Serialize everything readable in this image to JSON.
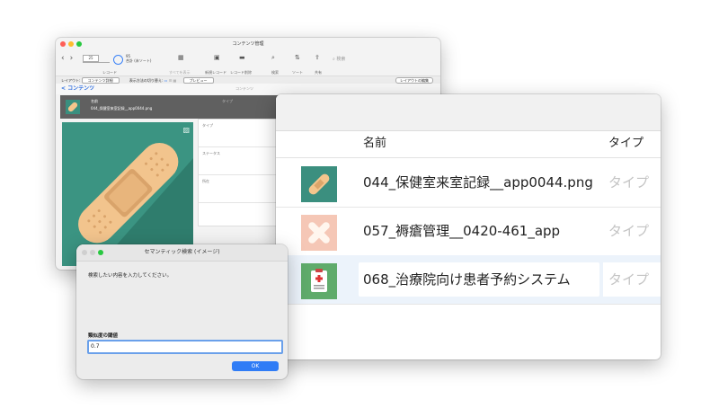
{
  "main_window": {
    "title": "コンテンツ管理",
    "toolbar": {
      "record_number": "25",
      "record_count": "95",
      "record_count_label": "合計 (未ソート)",
      "records_label": "レコード",
      "show_all": "すべてを表示",
      "new_record": "新規レコード",
      "delete_record": "レコード削除",
      "find": "検索",
      "sort": "ソート",
      "share": "共有",
      "search_placeholder": "検索"
    },
    "layout_bar": {
      "layout_label": "レイアウト:",
      "layout_value": "コンテンツ詳細",
      "view_label": "表示方法の切り替え:",
      "preview": "プレビュー",
      "edit_layout": "レイアウトの編集"
    },
    "nav": {
      "back": "< コンテンツ",
      "center_title": "コンテンツ"
    },
    "record": {
      "name_label": "名前",
      "name": "044_保健室来室記録__app0044.png",
      "type_label": "タイプ"
    },
    "fields": [
      "タイプ",
      "ステータス",
      "所在"
    ]
  },
  "table_window": {
    "columns": {
      "name": "名前",
      "type": "タイプ"
    },
    "rows": [
      {
        "name": "044_保健室来室記録__app0044.png",
        "type": "タイプ",
        "thumb_color": "#3b8f7f"
      },
      {
        "name": "057_褥瘡管理__0420-461_app",
        "type": "タイプ",
        "thumb_color": "#f5c7b6"
      },
      {
        "name": "068_治療院向け患者予約システム",
        "type": "タイプ",
        "thumb_color": "#5fab6b"
      }
    ]
  },
  "dialog": {
    "title": "セマンティック検索 (イメージ)",
    "prompt": "検索したい内容を入力してください。",
    "threshold_label": "類似度の閾値",
    "threshold_value": "0.7",
    "ok": "OK"
  },
  "colors": {
    "accent": "#2f7cf6",
    "record_header": "#606060",
    "image_bg": "#3b9482"
  }
}
